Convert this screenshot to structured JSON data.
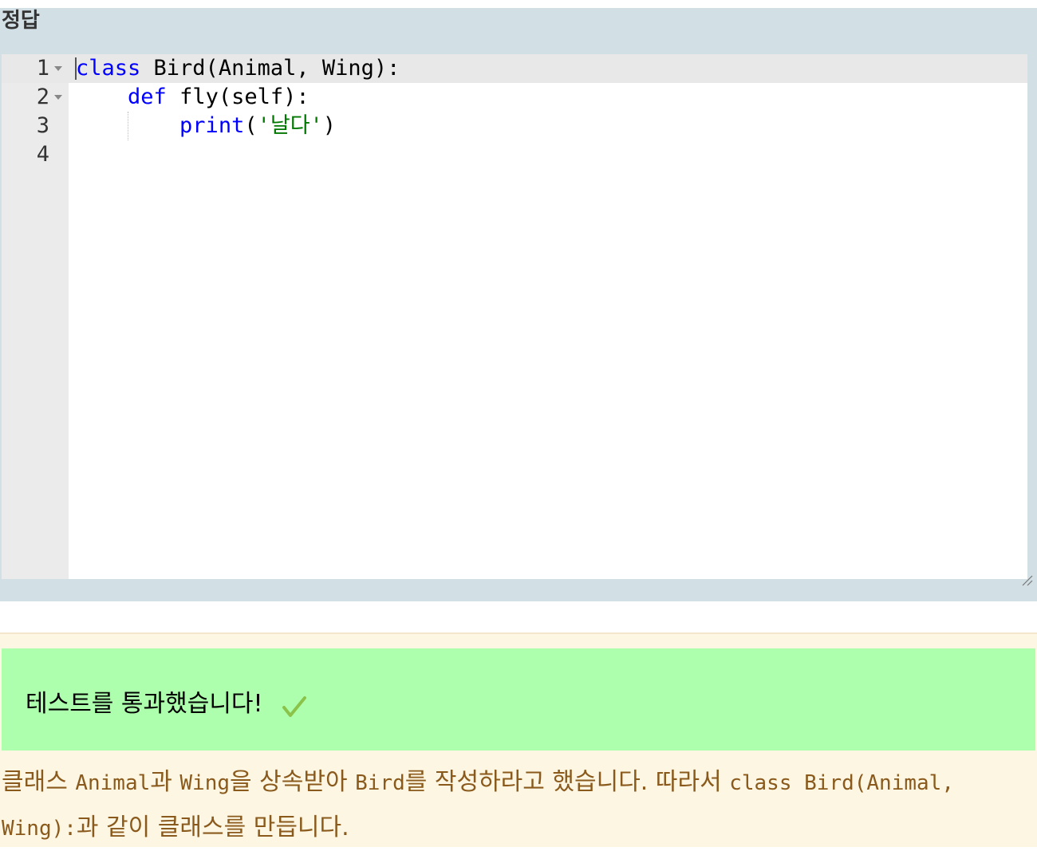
{
  "answer": {
    "title": "정답",
    "lines": [
      {
        "number": "1",
        "foldable": true,
        "tokens": [
          [
            "kw",
            "class"
          ],
          [
            "txt",
            " Bird(Animal, Wing):"
          ]
        ]
      },
      {
        "number": "2",
        "foldable": true,
        "tokens": [
          [
            "txt",
            "    "
          ],
          [
            "kw",
            "def"
          ],
          [
            "txt",
            " fly(self):"
          ]
        ]
      },
      {
        "number": "3",
        "foldable": false,
        "tokens": [
          [
            "txt",
            "        "
          ],
          [
            "kw",
            "print"
          ],
          [
            "txt",
            "("
          ],
          [
            "str",
            "'날다'"
          ],
          [
            "txt",
            ")"
          ]
        ]
      },
      {
        "number": "4",
        "foldable": false,
        "tokens": []
      }
    ]
  },
  "result": {
    "pass_message": "테스트를 통과했습니다!",
    "check_icon": "check-icon",
    "explanation_parts": [
      [
        "txt",
        "클래스 "
      ],
      [
        "mono",
        "Animal"
      ],
      [
        "txt",
        "과 "
      ],
      [
        "mono",
        "Wing"
      ],
      [
        "txt",
        "을 상속받아 "
      ],
      [
        "mono",
        "Bird"
      ],
      [
        "txt",
        "를 작성하라고 했습니다. 따라서 "
      ],
      [
        "mono",
        "class Bird(Animal, Wing):"
      ],
      [
        "txt",
        "과 같이 클래스를 만듭니다."
      ]
    ]
  },
  "colors": {
    "keyword": "#0000ff",
    "string": "#007700",
    "pass_bg": "#adffad",
    "check": "#8bc34a",
    "explanation_text": "#8a5a1c",
    "answer_bg": "#d2e0e6"
  }
}
